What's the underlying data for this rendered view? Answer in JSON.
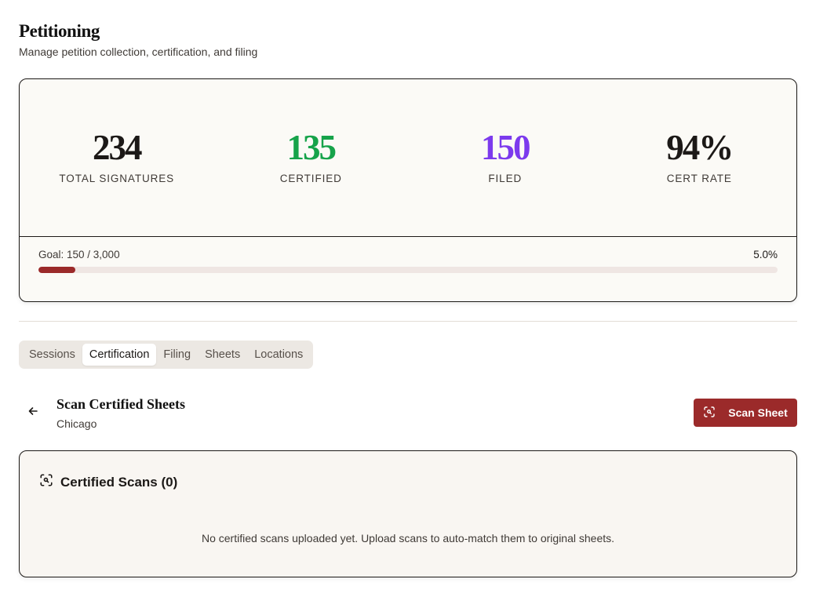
{
  "header": {
    "title": "Petitioning",
    "subtitle": "Manage petition collection, certification, and filing"
  },
  "stats": [
    {
      "value": "234",
      "label": "TOTAL SIGNATURES",
      "color": "#1c1917"
    },
    {
      "value": "135",
      "label": "CERTIFIED",
      "color": "#16a34a"
    },
    {
      "value": "150",
      "label": "FILED",
      "color": "#7c3aed"
    },
    {
      "value": "94%",
      "label": "CERT RATE",
      "color": "#1c1917"
    }
  ],
  "goal": {
    "label": "Goal: 150 / 3,000",
    "percent_label": "5.0%",
    "progress_fraction": 0.05,
    "bar_color": "#9b2a2a"
  },
  "tabs": [
    {
      "label": "Sessions",
      "active": false
    },
    {
      "label": "Certification",
      "active": true
    },
    {
      "label": "Filing",
      "active": false
    },
    {
      "label": "Sheets",
      "active": false
    },
    {
      "label": "Locations",
      "active": false
    }
  ],
  "section": {
    "back_icon": "arrow-left-icon",
    "title": "Scan Certified Sheets",
    "subtitle": "Chicago",
    "scan_button_label": "Scan Sheet",
    "scan_button_icon": "scan-icon",
    "accent": "#9b2a2a"
  },
  "scans": {
    "icon": "scan-search-icon",
    "title": "Certified Scans (0)",
    "empty_message": "No certified scans uploaded yet. Upload scans to auto-match them to original sheets."
  }
}
